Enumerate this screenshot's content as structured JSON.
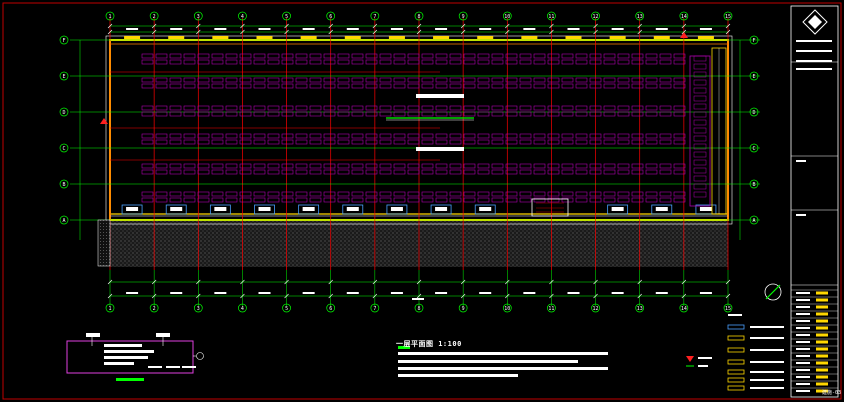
{
  "drawing": {
    "plan_title": "一层平面图",
    "plan_scale": "1:100",
    "sheet_number": "建施-03"
  },
  "axes": {
    "columns": [
      "1",
      "2",
      "3",
      "4",
      "5",
      "6",
      "7",
      "8",
      "9",
      "10",
      "11",
      "12",
      "13",
      "14",
      "15"
    ],
    "rows": [
      "A",
      "B",
      "C",
      "D",
      "E",
      "F"
    ]
  },
  "colors": {
    "background": "#000000",
    "frame": "#c00000",
    "axis_line": "#00ff00",
    "column_grid": "#ff0000",
    "wall": "#ffd800",
    "furniture": "#b000b0",
    "text": "#ffffff",
    "dimension": "#00ff00",
    "hatch": "#8a8a8a"
  },
  "icons": {
    "north_arrow": "north-arrow-icon",
    "logo": "company-seal-icon",
    "marker": "warning-triangle-icon"
  }
}
